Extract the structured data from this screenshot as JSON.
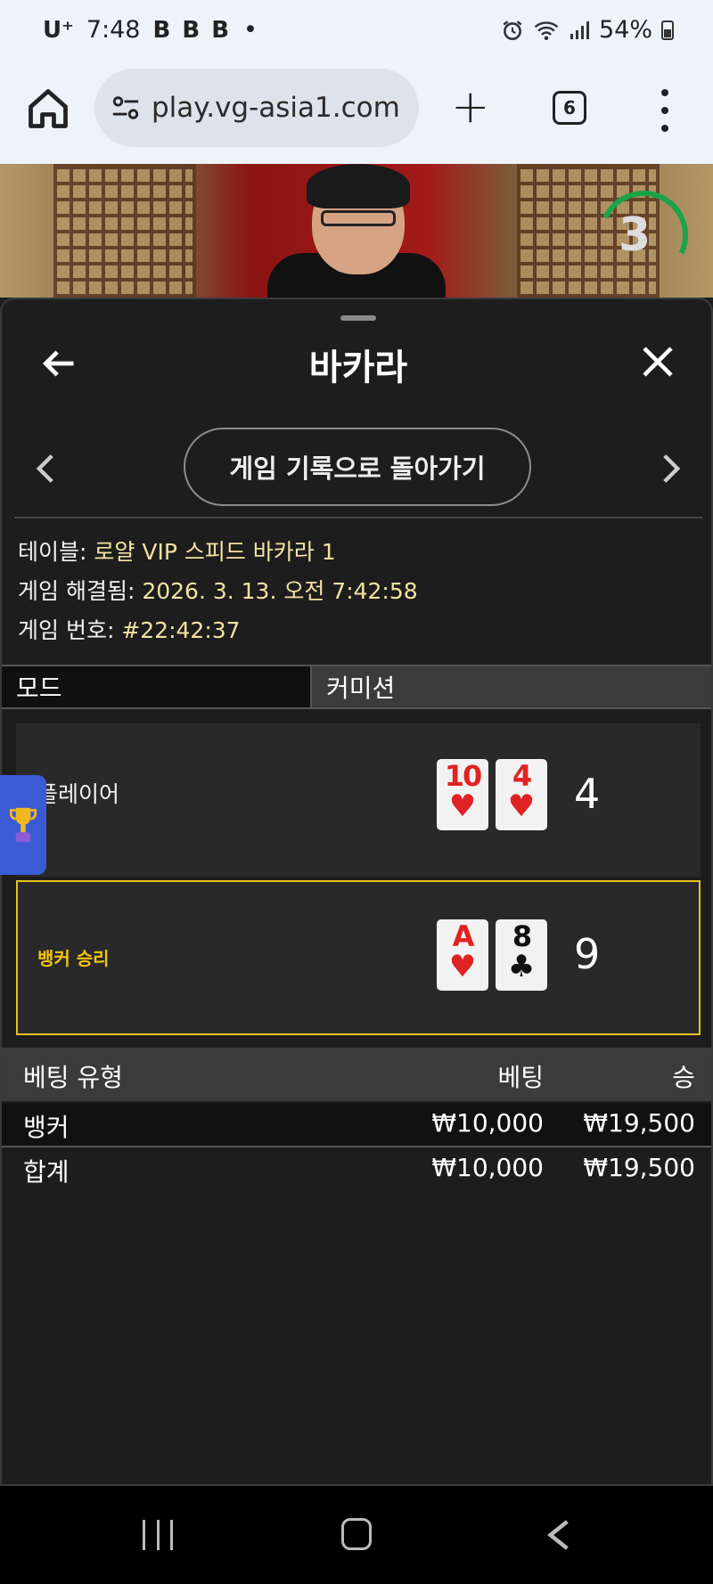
{
  "status_bar": {
    "carrier": "U⁺",
    "time": "7:48",
    "notif_icons": "B B B",
    "dot": "•",
    "battery_pct": "54%"
  },
  "browser": {
    "url": "play.vg-asia1.com",
    "tab_count": "6"
  },
  "video": {
    "countdown": "3"
  },
  "panel": {
    "title": "바카라",
    "back_history_label": "게임 기록으로 돌아가기",
    "table_label": "테이블:",
    "table_value": "로얄 VIP 스피드 바카라 1",
    "resolved_label": "게임 해결됨:",
    "resolved_value": "2026. 3. 13. 오전 7:42:58",
    "game_no_label": "게임 번호:",
    "game_no_value": "#22:42:37",
    "mode_label": "모드",
    "commission_label": "커미션"
  },
  "player": {
    "label": "플레이어",
    "cards": [
      {
        "rank": "10",
        "suit": "♥",
        "color": "red"
      },
      {
        "rank": "4",
        "suit": "♥",
        "color": "red"
      }
    ],
    "total": "4"
  },
  "banker": {
    "label": "뱅커 승리",
    "cards": [
      {
        "rank": "A",
        "suit": "♥",
        "color": "red"
      },
      {
        "rank": "8",
        "suit": "♣",
        "color": "black"
      }
    ],
    "total": "9"
  },
  "bets": {
    "headers": {
      "type": "베팅 유형",
      "bet": "베팅",
      "win": "승"
    },
    "rows": [
      {
        "type": "뱅커",
        "bet": "₩10,000",
        "win": "₩19,500"
      },
      {
        "type": "합계",
        "bet": "₩10,000",
        "win": "₩19,500"
      }
    ]
  },
  "colors": {
    "highlight": "#e5c21a",
    "value_text": "#f3e3a2",
    "timer_arc": "#1aa348"
  }
}
